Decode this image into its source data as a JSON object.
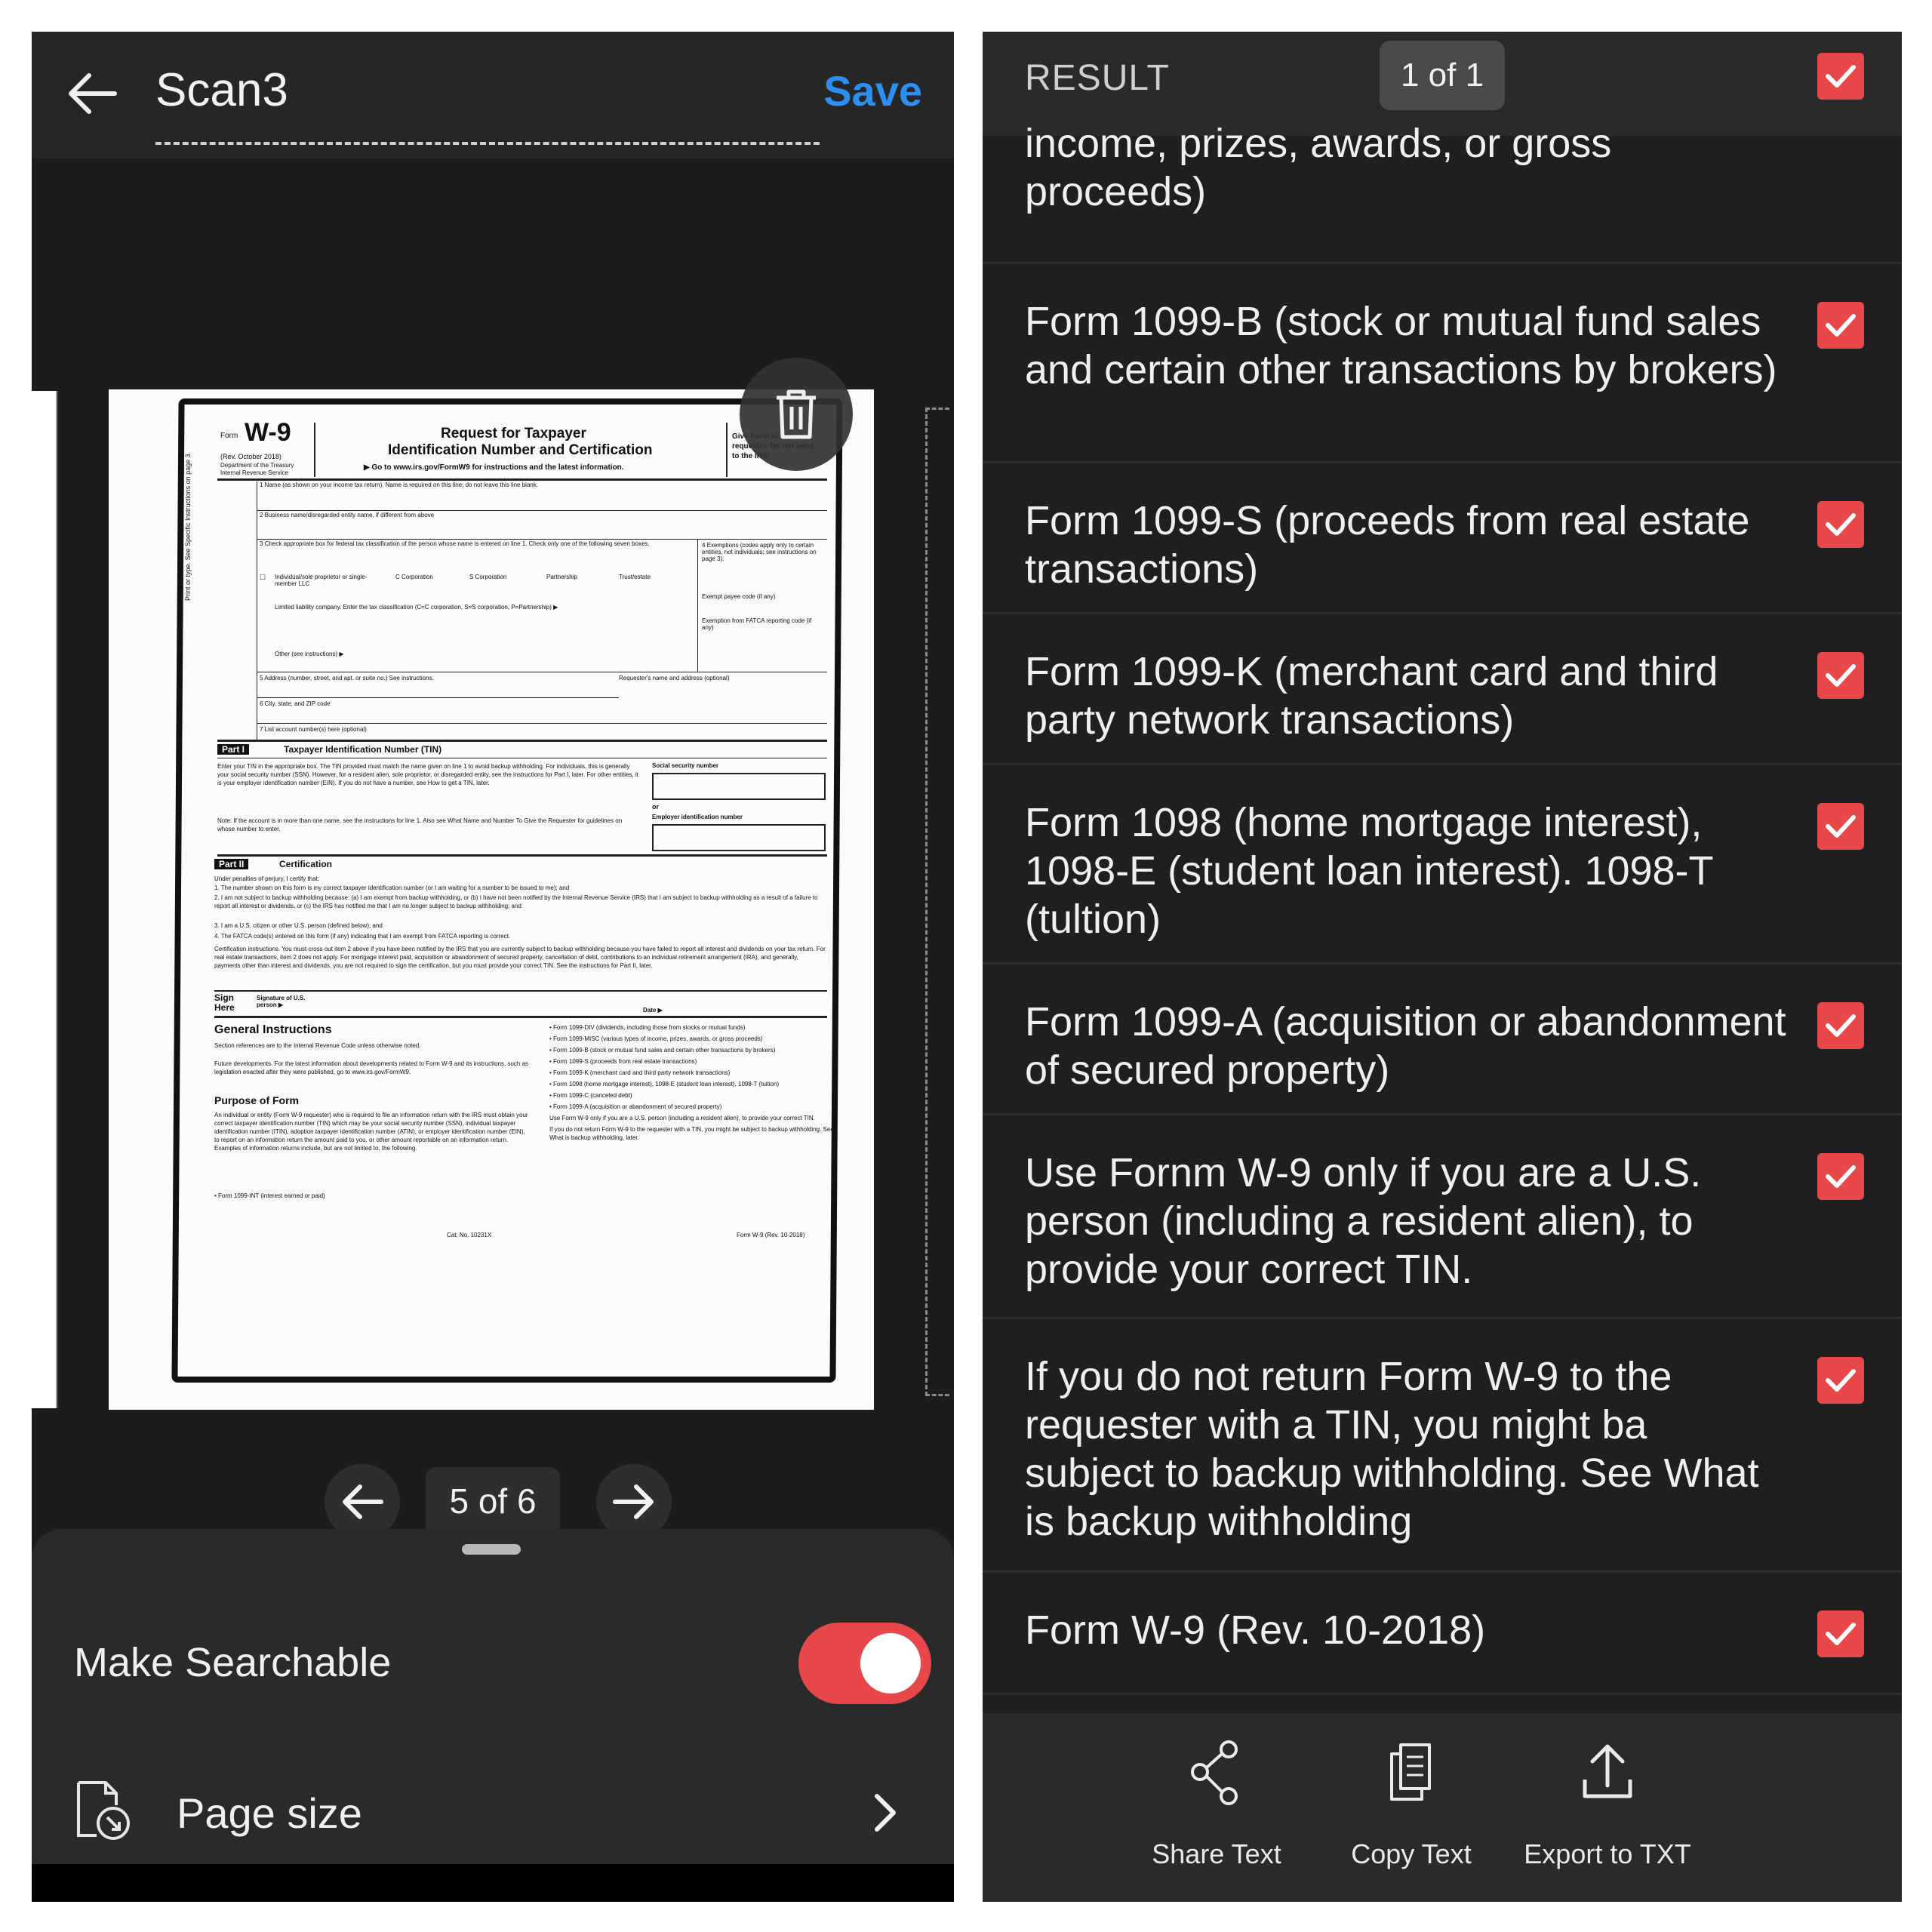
{
  "editor": {
    "title": "Scan3",
    "save_label": "Save",
    "page_indicator": "5 of 6"
  },
  "document_preview": {
    "form_prefix": "Form",
    "form_name": "W-9",
    "rev": "(Rev. October 2018)",
    "dept1": "Department of the Treasury",
    "dept2": "Internal Revenue Service",
    "title1": "Request for Taxpayer",
    "title2": "Identification Number and Certification",
    "goto": "▶ Go to www.irs.gov/FormW9 for instructions and the latest information.",
    "give_form": "Give Form to the requester. Do not send to the IRS.",
    "line1": "1 Name (as shown on your income tax return). Name is required on this line; do not leave this line blank.",
    "line2": "2 Business name/disregarded entity name, if different from above",
    "line3": "3 Check appropriate box for federal tax classification of the person whose name is entered on line 1. Check only one of the following seven boxes.",
    "box_individual": "Individual/sole proprietor or single-member LLC",
    "box_ccorp": "C Corporation",
    "box_scorp": "S Corporation",
    "box_partnership": "Partnership",
    "box_trust": "Trust/estate",
    "llc_line": "Limited liability company. Enter the tax classification (C=C corporation, S=S corporation, P=Partnership) ▶",
    "other_line": "Other (see instructions) ▶",
    "exemptions": "4 Exemptions (codes apply only to certain entities, not individuals; see instructions on page 3):",
    "exempt_payee": "Exempt payee code (if any)",
    "fatca": "Exemption from FATCA reporting code (if any)",
    "line5": "5 Address (number, street, and apt. or suite no.) See instructions.",
    "requester": "Requester's name and address (optional)",
    "line6": "6 City, state, and ZIP code",
    "line7": "7 List account number(s) here (optional)",
    "side_label": "Print or type.   See Specific Instructions on page 3.",
    "part1": "Part I",
    "part1_title": "Taxpayer Identification Number (TIN)",
    "part1_text": "Enter your TIN in the appropriate box. The TIN provided must match the name given on line 1 to avoid backup withholding. For individuals, this is generally your social security number (SSN). However, for a resident alien, sole proprietor, or disregarded entity, see the instructions for Part I, later. For other entities, it is your employer identification number (EIN). If you do not have a number, see How to get a TIN, later.",
    "part1_note": "Note: If the account is in more than one name, see the instructions for line 1. Also see What Name and Number To Give the Requester for guidelines on whose number to enter.",
    "ssn": "Social security number",
    "or": "or",
    "ein": "Employer identification number",
    "part2": "Part II",
    "part2_title": "Certification",
    "cert_intro": "Under penalties of perjury, I certify that:",
    "cert1": "1. The number shown on this form is my correct taxpayer identification number (or I am waiting for a number to be issued to me); and",
    "cert2": "2. I am not subject to backup withholding because: (a) I am exempt from backup withholding, or (b) I have not been notified by the Internal Revenue Service (IRS) that I am subject to backup withholding as a result of a failure to report all interest or dividends, or (c) the IRS has notified me that I am no longer subject to backup withholding; and",
    "cert3": "3. I am a U.S. citizen or other U.S. person (defined below); and",
    "cert4": "4. The FATCA code(s) entered on this form (if any) indicating that I am exempt from FATCA reporting is correct.",
    "cert_instr": "Certification instructions. You must cross out item 2 above if you have been notified by the IRS that you are currently subject to backup withholding because you have failed to report all interest and dividends on your tax return. For real estate transactions, item 2 does not apply. For mortgage interest paid, acquisition or abandonment of secured property, cancellation of debt, contributions to an individual retirement arrangement (IRA), and generally, payments other than interest and dividends, you are not required to sign the certification, but you must provide your correct TIN. See the instructions for Part II, later.",
    "sign_here": "Sign Here",
    "signature": "Signature of U.S. person ▶",
    "date": "Date ▶",
    "gen_instr": "General Instructions",
    "gen_text": "Section references are to the Internal Revenue Code unless otherwise noted.",
    "future": "Future developments. For the latest information about developments related to Form W-9 and its instructions, such as legislation enacted after they were published, go to www.irs.gov/FormW9.",
    "purpose": "Purpose of Form",
    "purpose_text": "An individual or entity (Form W-9 requester) who is required to file an information return with the IRS must obtain your correct taxpayer identification number (TIN) which may be your social security number (SSN), individual taxpayer identification number (ITIN), adoption taxpayer identification number (ATIN), or employer identification number (EIN), to report on an information return the amount paid to you, or other amount reportable on an information return. Examples of information returns include, but are not limited to, the following.",
    "int": "• Form 1099-INT (interest earned or paid)",
    "right_col": [
      "• Form 1099-DIV (dividends, including those from stocks or mutual funds)",
      "• Form 1099-MISC (various types of income, prizes, awards, or gross proceeds)",
      "• Form 1099-B (stock or mutual fund sales and certain other transactions by brokers)",
      "• Form 1099-S (proceeds from real estate transactions)",
      "• Form 1099-K (merchant card and third party network transactions)",
      "• Form 1098 (home mortgage interest), 1098-E (student loan interest), 1098-T (tuition)",
      "• Form 1099-C (canceled debt)",
      "• Form 1099-A (acquisition or abandonment of secured property)",
      "Use Form W-9 only if you are a U.S. person (including a resident alien), to provide your correct TIN.",
      "If you do not return Form W-9 to the requester with a TIN, you might be subject to backup withholding. See What is backup withholding, later."
    ],
    "cat_no": "Cat. No. 10231X",
    "footer_form": "Form W-9 (Rev. 10-2018)"
  },
  "bottom_sheet": {
    "make_searchable_label": "Make Searchable",
    "make_searchable_on": true,
    "page_size_label": "Page size"
  },
  "result": {
    "header_label": "RESULT",
    "count": "1 of 1",
    "items": [
      {
        "text": "income, prizes, awards, or gross proceeds)",
        "checked": true
      },
      {
        "text": "Form 1099-B (stock or mutual fund sales and certain other transactions by brokers)",
        "checked": true
      },
      {
        "text": "Form 1099-S (proceeds from real estate transactions)",
        "checked": true
      },
      {
        "text": "Form 1099-K (merchant card and third party network transactions)",
        "checked": true
      },
      {
        "text": "Form 1098 (home mortgage interest), 1098-E (student loan interest). 1098-T (tultion)",
        "checked": true
      },
      {
        "text": "Form 1099-A (acquisition or abandonment of secured property)",
        "checked": true
      },
      {
        "text": "Use Fornm W-9 only if you are a U.S. person (including a resident alien), to provide your correct TIN.",
        "checked": true
      },
      {
        "text": "If you do not return Form W-9 to the requester with a TIN, you might ba subject to backup withholding. See What is backup withholding",
        "checked": true
      },
      {
        "text": "Form W-9 (Rev. 10-2018)",
        "checked": true
      }
    ],
    "actions": {
      "share": "Share Text",
      "copy": "Copy Text",
      "export": "Export to TXT"
    }
  },
  "colors": {
    "accent_red": "#e8484a",
    "save_blue": "#2b8ef0",
    "panel_dark": "#1c1c1c"
  },
  "icons": [
    "back-arrow-icon",
    "trash-icon",
    "arrow-left-icon",
    "arrow-right-icon",
    "page-size-icon",
    "chevron-right-icon",
    "checkmark-icon",
    "share-icon",
    "copy-icon",
    "export-icon"
  ]
}
